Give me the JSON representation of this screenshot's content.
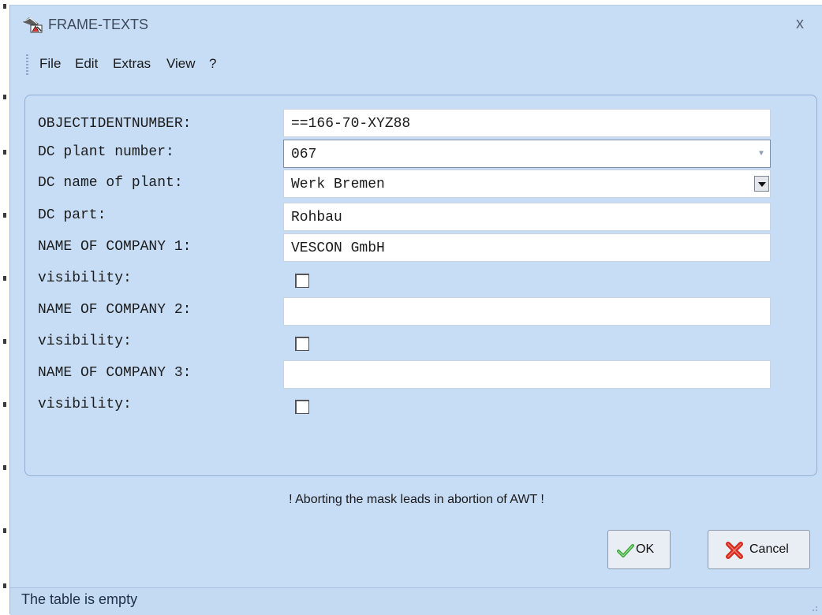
{
  "window": {
    "title": "FRAME-TEXTS",
    "close_glyph": "x",
    "icon": "app-tools-icon"
  },
  "menu": {
    "items": [
      {
        "label": "File"
      },
      {
        "label": "Edit"
      },
      {
        "label": "Extras"
      },
      {
        "label": "View"
      },
      {
        "label": "?"
      }
    ]
  },
  "form": {
    "object_ident": {
      "label": "OBJECTIDENTNUMBER:",
      "value": "==166-70-XYZ88"
    },
    "plant_number": {
      "label": "DC plant number:",
      "value": "067"
    },
    "plant_name": {
      "label": "DC name of plant:",
      "value": "Werk Bremen"
    },
    "part": {
      "label": "DC part:",
      "value": "Rohbau"
    },
    "company1": {
      "label": "NAME OF COMPANY 1:",
      "value": "VESCON GmbH"
    },
    "visibility1": {
      "label": "visibility:",
      "checked": false
    },
    "company2": {
      "label": "NAME OF COMPANY 2:",
      "value": ""
    },
    "visibility2": {
      "label": "visibility:",
      "checked": false
    },
    "company3": {
      "label": "NAME OF COMPANY 3:",
      "value": ""
    },
    "visibility3": {
      "label": "visibility:",
      "checked": false
    }
  },
  "warning": "! Aborting the mask leads in abortion of AWT  !",
  "buttons": {
    "ok": "OK",
    "cancel": "Cancel"
  },
  "status": "The table is empty",
  "colors": {
    "window_bg": "#c7dcf5",
    "panel_border": "#8faed6",
    "ok_check": "#3aa63a",
    "cancel_x": "#d42a1e"
  }
}
